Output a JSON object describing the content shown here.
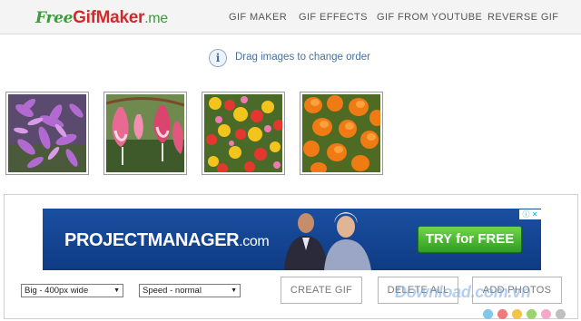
{
  "header": {
    "logo": {
      "part1": "Free",
      "part2": "GifMaker",
      "part3": ".me"
    },
    "nav": [
      "GIF MAKER",
      "GIF EFFECTS",
      "GIF FROM YOUTUBE",
      "REVERSE GIF"
    ]
  },
  "info": {
    "icon": "info-icon",
    "text": "Drag images to change order"
  },
  "thumbnails": [
    {
      "subject": "purple-flowers"
    },
    {
      "subject": "pink-bleeding-hearts"
    },
    {
      "subject": "mixed-flowers"
    },
    {
      "subject": "orange-tulips"
    }
  ],
  "ad": {
    "brand": "PROJECTMANAGER",
    "domain": ".com",
    "cta": "TRY for FREE",
    "choices_icon": "adchoices-icon"
  },
  "controls": {
    "size_select": "Big - 400px wide",
    "speed_select": "Speed - normal",
    "create_gif": "CREATE GIF",
    "delete_all": "DELETE ALL",
    "add_photos": "ADD PHOTOS"
  },
  "watermark": {
    "text": "Download.com.vn"
  },
  "colors": {
    "logo_green": "#3c9b3c",
    "logo_red": "#d22a2a",
    "info_blue": "#4a6f9c",
    "ad_blue": "#1a4fa0",
    "cta_green": "#3fae2a"
  }
}
